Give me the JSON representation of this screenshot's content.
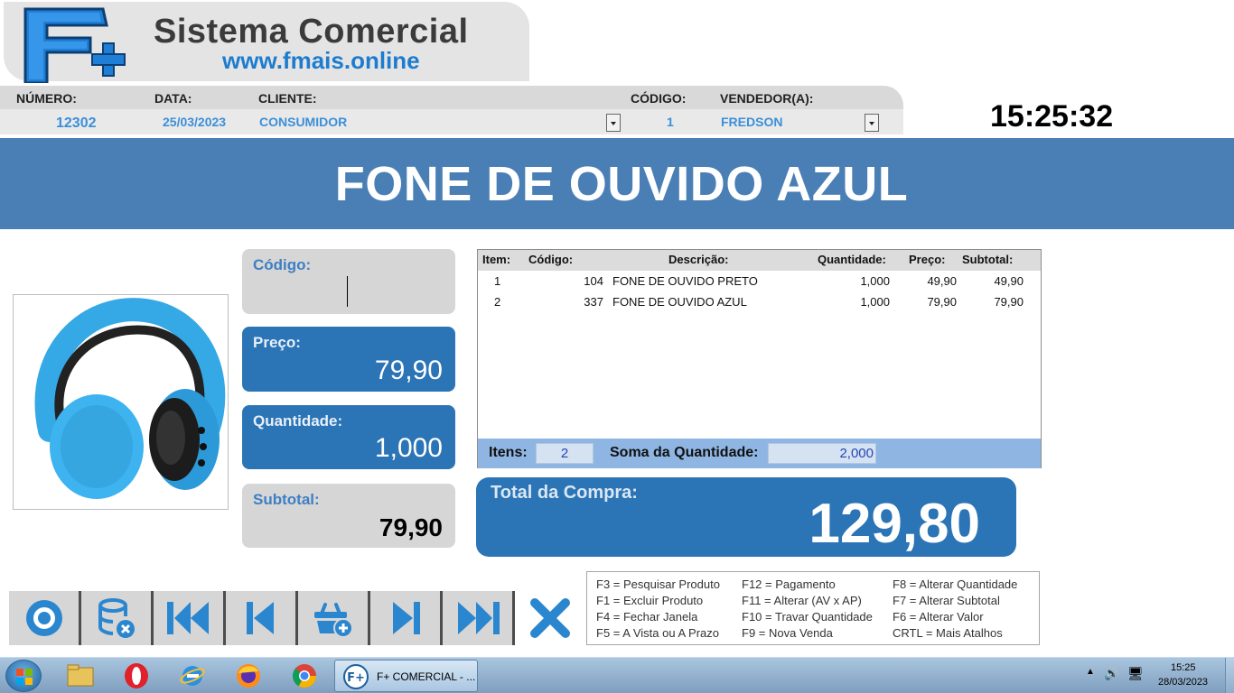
{
  "app": {
    "logo_title": "Sistema Comercial",
    "logo_url": "www.fmais.online",
    "logo_mark": "F+"
  },
  "header": {
    "numero_label": "NÚMERO:",
    "numero_value": "12302",
    "data_label": "DATA:",
    "data_value": "25/03/2023",
    "cliente_label": "CLIENTE:",
    "cliente_value": "CONSUMIDOR",
    "codigo_label": "CÓDIGO:",
    "codigo_value": "1",
    "vendedor_label": "VENDEDOR(A):",
    "vendedor_value": "FREDSON",
    "clock": "15:25:32"
  },
  "banner": {
    "product_name": "FONE DE OUVIDO AZUL"
  },
  "product_image": {
    "icon": "blue-headphones-image"
  },
  "fields": {
    "codigo_label": "Código:",
    "preco_label": "Preço:",
    "preco_value": "79,90",
    "quantidade_label": "Quantidade:",
    "quantidade_value": "1,000",
    "subtotal_label": "Subtotal:",
    "subtotal_value": "79,90"
  },
  "table": {
    "headers": {
      "item": "Item:",
      "codigo": "Código:",
      "descricao": "Descrição:",
      "quantidade": "Quantidade:",
      "preco": "Preço:",
      "subtotal": "Subtotal:"
    },
    "rows": [
      {
        "item": "1",
        "codigo": "104",
        "descricao": "FONE DE OUVIDO PRETO",
        "quantidade": "1,000",
        "preco": "49,90",
        "subtotal": "49,90"
      },
      {
        "item": "2",
        "codigo": "337",
        "descricao": "FONE DE OUVIDO AZUL",
        "quantidade": "1,000",
        "preco": "79,90",
        "subtotal": "79,90"
      }
    ],
    "footer": {
      "itens_label": "Itens:",
      "itens_value": "2",
      "soma_label": "Soma da Quantidade:",
      "soma_value": "2,000"
    }
  },
  "total": {
    "label": "Total da Compra:",
    "value": "129,80"
  },
  "toolbar": {
    "buttons": [
      "disc-icon",
      "database-delete-icon",
      "first-record-icon",
      "previous-record-icon",
      "cart-add-icon",
      "next-record-icon",
      "last-record-icon",
      "close-x-icon"
    ]
  },
  "shortcuts": [
    "F3 = Pesquisar Produto",
    "F12 = Pagamento",
    "F8 = Alterar Quantidade",
    "F1 = Excluir Produto",
    "F11 = Alterar (AV x AP)",
    "F7 = Alterar Subtotal",
    "F4 = Fechar Janela",
    "F10 = Travar Quantidade",
    "F6 = Alterar Valor",
    "F5 = A Vista ou A Prazo",
    "F9 = Nova Venda",
    "CRTL = Mais Atalhos"
  ],
  "taskbar": {
    "task_label": "F+ COMERCIAL - ...",
    "task_icon_text": "F+",
    "tray_time": "15:25",
    "tray_date": "28/03/2023"
  },
  "colors": {
    "banner": "#4a7fb5",
    "panel_blue": "#2b74b5",
    "panel_grey": "#d6d6d6",
    "accent_blue": "#1d7ccf",
    "table_footer": "#8fb6e3"
  }
}
